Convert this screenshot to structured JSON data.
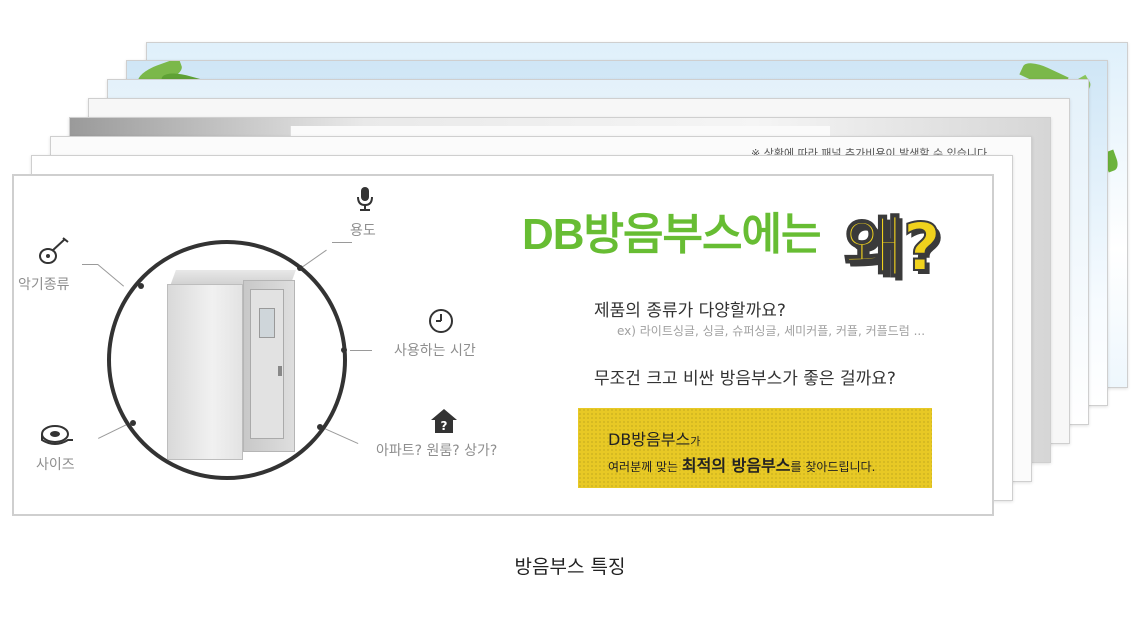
{
  "slides_back": {
    "notice_text": "※ 상황에 따라 패널 추가비용이 발생할 수 있습니다"
  },
  "slide_front": {
    "headline": "DB방음부스에는",
    "headline_accent": "왜?",
    "features": {
      "usage": "용도",
      "instrument": "악기종류",
      "time": "사용하는 시간",
      "place": "아파트? 원룸? 상가?",
      "size": "사이즈"
    },
    "question_1": "제품의 종류가 다양할까요?",
    "example": "ex)  라이트싱글, 싱글, 슈퍼싱글, 세미커플, 커플, 커플드럼 ...",
    "question_2": "무조건 크고 비싼 방음부스가 좋은 걸까요?",
    "answer": {
      "line1_strong": "DB방음부스",
      "line1_suffix": "가",
      "line2_prefix": "여러분께 맞는 ",
      "line2_strong": "최적의 방음부스",
      "line2_suffix": "를 찾아드립니다."
    },
    "colors": {
      "headline": "#67bd33",
      "accent": "#f0d21d",
      "answer_box": "#e8c925"
    }
  },
  "caption": "방음부스 특징",
  "icons": [
    "microphone-icon",
    "guitar-icon",
    "clock-icon",
    "house-question-icon",
    "tape-measure-icon"
  ]
}
